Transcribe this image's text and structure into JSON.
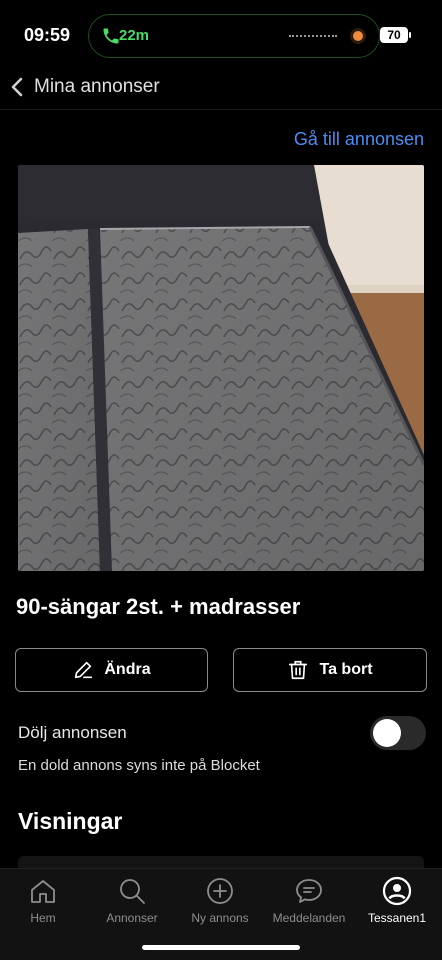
{
  "status_bar": {
    "time": "09:59",
    "call_duration": "22m",
    "battery": "70"
  },
  "nav": {
    "back_icon": "chevron-left-icon",
    "title": "Mina annonser"
  },
  "goto_link": "Gå till annonsen",
  "ad": {
    "title": "90-sängar 2st. + madrasser",
    "edit_label": "Ändra",
    "delete_label": "Ta bort"
  },
  "hide": {
    "label": "Dölj annonsen",
    "description": "En dold annons syns inte på Blocket",
    "toggle_on": false
  },
  "views_heading": "Visningar",
  "tabs": [
    {
      "label": "Hem",
      "icon": "home-icon"
    },
    {
      "label": "Annonser",
      "icon": "search-icon"
    },
    {
      "label": "Ny annons",
      "icon": "plus-circle-icon"
    },
    {
      "label": "Meddelanden",
      "icon": "chat-icon"
    },
    {
      "label": "Tessanen1",
      "icon": "profile-icon",
      "active": true
    }
  ],
  "colors": {
    "accent_link": "#4a8ef5",
    "call_green": "#4cd964",
    "background": "#000000"
  }
}
